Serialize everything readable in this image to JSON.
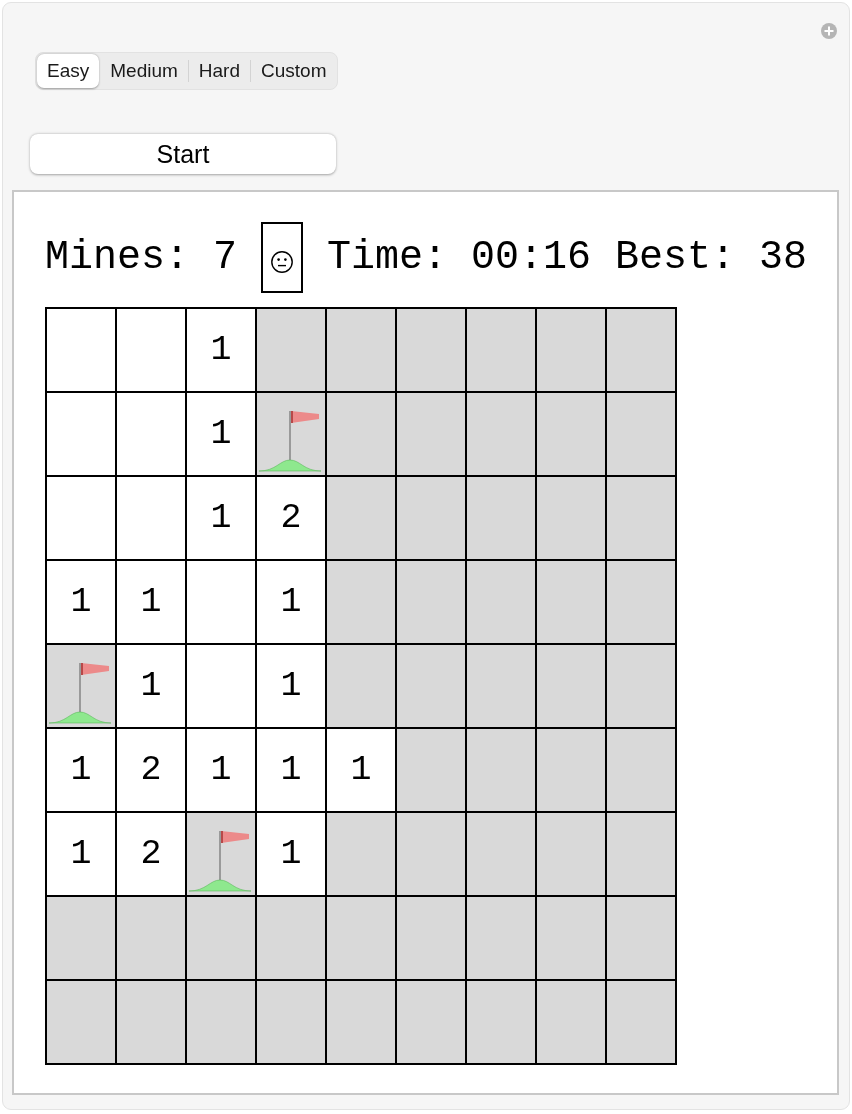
{
  "difficulty_tabs": [
    {
      "label": "Easy",
      "selected": true
    },
    {
      "label": "Medium",
      "selected": false
    },
    {
      "label": "Hard",
      "selected": false
    },
    {
      "label": "Custom",
      "selected": false
    }
  ],
  "start_button": {
    "label": "Start"
  },
  "status": {
    "mines": "Mines: 7",
    "time": "Time: 00:16",
    "best": "Best: 38"
  },
  "board": {
    "rows": [
      [
        {
          "kind": "open"
        },
        {
          "kind": "open"
        },
        {
          "kind": "open",
          "label": "1"
        },
        {
          "kind": "hidden"
        },
        {
          "kind": "hidden"
        },
        {
          "kind": "hidden"
        },
        {
          "kind": "hidden"
        },
        {
          "kind": "hidden"
        },
        {
          "kind": "hidden"
        }
      ],
      [
        {
          "kind": "open"
        },
        {
          "kind": "open"
        },
        {
          "kind": "open",
          "label": "1"
        },
        {
          "kind": "flag"
        },
        {
          "kind": "hidden"
        },
        {
          "kind": "hidden"
        },
        {
          "kind": "hidden"
        },
        {
          "kind": "hidden"
        },
        {
          "kind": "hidden"
        }
      ],
      [
        {
          "kind": "open"
        },
        {
          "kind": "open"
        },
        {
          "kind": "open",
          "label": "1"
        },
        {
          "kind": "open",
          "label": "2"
        },
        {
          "kind": "hidden"
        },
        {
          "kind": "hidden"
        },
        {
          "kind": "hidden"
        },
        {
          "kind": "hidden"
        },
        {
          "kind": "hidden"
        }
      ],
      [
        {
          "kind": "open",
          "label": "1"
        },
        {
          "kind": "open",
          "label": "1"
        },
        {
          "kind": "open"
        },
        {
          "kind": "open",
          "label": "1"
        },
        {
          "kind": "hidden"
        },
        {
          "kind": "hidden"
        },
        {
          "kind": "hidden"
        },
        {
          "kind": "hidden"
        },
        {
          "kind": "hidden"
        }
      ],
      [
        {
          "kind": "flag"
        },
        {
          "kind": "open",
          "label": "1"
        },
        {
          "kind": "open"
        },
        {
          "kind": "open",
          "label": "1"
        },
        {
          "kind": "hidden"
        },
        {
          "kind": "hidden"
        },
        {
          "kind": "hidden"
        },
        {
          "kind": "hidden"
        },
        {
          "kind": "hidden"
        }
      ],
      [
        {
          "kind": "open",
          "label": "1"
        },
        {
          "kind": "open",
          "label": "2"
        },
        {
          "kind": "open",
          "label": "1"
        },
        {
          "kind": "open",
          "label": "1"
        },
        {
          "kind": "open",
          "label": "1"
        },
        {
          "kind": "hidden"
        },
        {
          "kind": "hidden"
        },
        {
          "kind": "hidden"
        },
        {
          "kind": "hidden"
        }
      ],
      [
        {
          "kind": "open",
          "label": "1"
        },
        {
          "kind": "open",
          "label": "2"
        },
        {
          "kind": "flag"
        },
        {
          "kind": "open",
          "label": "1"
        },
        {
          "kind": "hidden"
        },
        {
          "kind": "hidden"
        },
        {
          "kind": "hidden"
        },
        {
          "kind": "hidden"
        },
        {
          "kind": "hidden"
        }
      ],
      [
        {
          "kind": "hidden"
        },
        {
          "kind": "hidden"
        },
        {
          "kind": "hidden"
        },
        {
          "kind": "hidden"
        },
        {
          "kind": "hidden"
        },
        {
          "kind": "hidden"
        },
        {
          "kind": "hidden"
        },
        {
          "kind": "hidden"
        },
        {
          "kind": "hidden"
        }
      ],
      [
        {
          "kind": "hidden"
        },
        {
          "kind": "hidden"
        },
        {
          "kind": "hidden"
        },
        {
          "kind": "hidden"
        },
        {
          "kind": "hidden"
        },
        {
          "kind": "hidden"
        },
        {
          "kind": "hidden"
        },
        {
          "kind": "hidden"
        },
        {
          "kind": "hidden"
        }
      ]
    ]
  }
}
